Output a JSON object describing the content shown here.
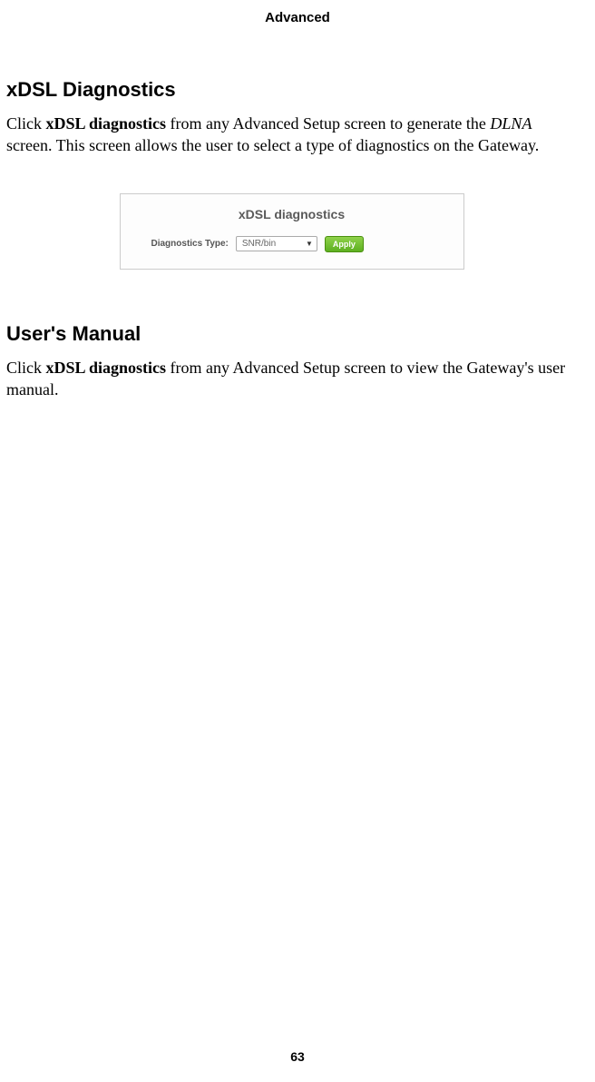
{
  "header": {
    "title": "Advanced"
  },
  "section1": {
    "heading": "xDSL Diagnostics",
    "para_prefix": "Click ",
    "para_bold": "xDSL diagnostics",
    "para_mid": " from any Advanced Setup screen to generate the ",
    "para_italic": "DLNA",
    "para_suffix": " screen. This screen allows the user to select a type of diagnostics on the Gateway."
  },
  "screenshot": {
    "title": "xDSL diagnostics",
    "label": "Diagnostics Type:",
    "select_value": "SNR/bin",
    "button_label": "Apply"
  },
  "section2": {
    "heading": "User's Manual",
    "para_prefix": "Click ",
    "para_bold": "xDSL diagnostics",
    "para_suffix": " from any Advanced Setup screen to view the Gateway's user manual."
  },
  "footer": {
    "page_number": "63"
  }
}
